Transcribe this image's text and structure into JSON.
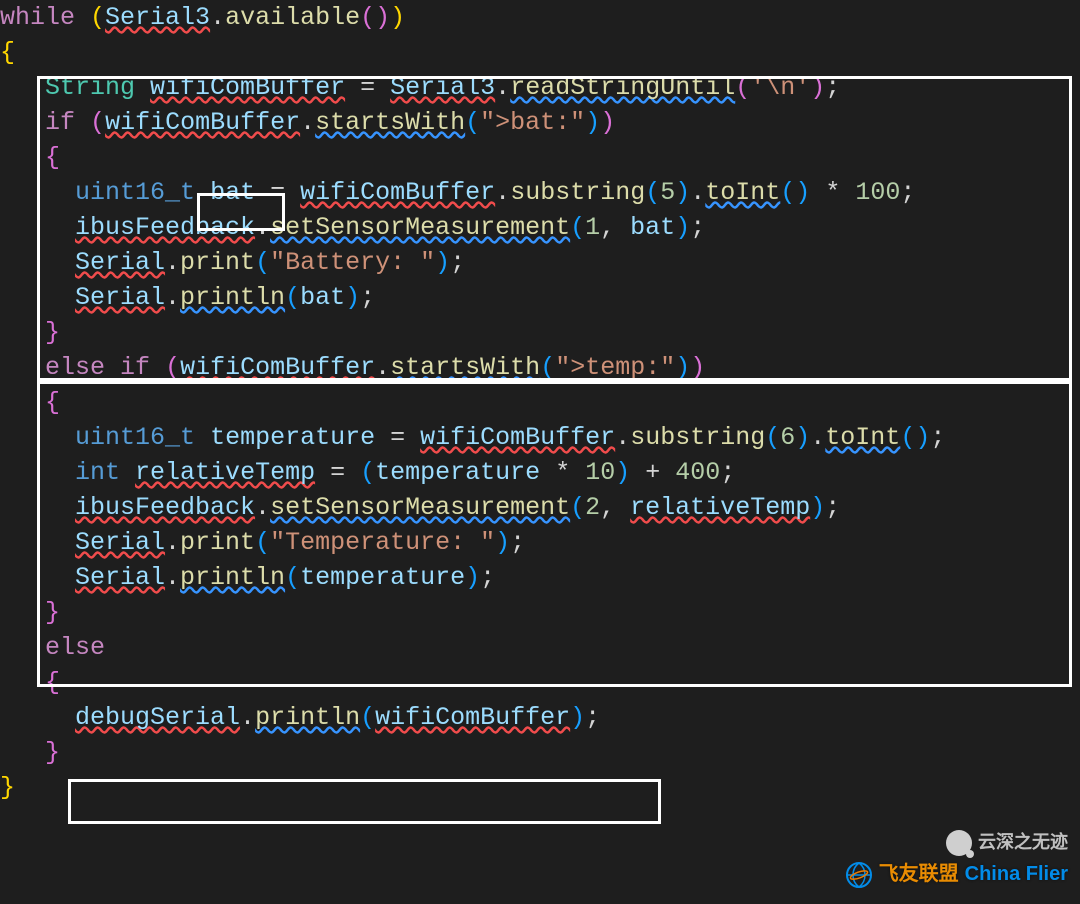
{
  "code": {
    "l1": {
      "kw": "while",
      "obj": "Serial3",
      "dot": ".",
      "fn": "available"
    },
    "l2": {
      "brace": "{"
    },
    "l3": {
      "cls": "String",
      "var": "wifiComBuffer",
      "eq": "=",
      "obj": "Serial3",
      "fn": "readStringUntil",
      "arg": "'\\n'"
    },
    "l4": {
      "kw": "if",
      "var": "wifiComBuffer",
      "fn": "startsWith",
      "arg": "\">bat:\""
    },
    "l5": {
      "brace": "{"
    },
    "l6": {
      "typ": "uint16_t",
      "var": "bat",
      "eq": "=",
      "obj": "wifiComBuffer",
      "fn1": "substring",
      "arg1": "5",
      "fn2": "toInt",
      "op": "*",
      "mul": "100"
    },
    "l7": {
      "obj": "ibusFeedback",
      "fn": "setSensorMeasurement",
      "a1": "1",
      "a2": "bat"
    },
    "l8": {
      "obj": "Serial",
      "fn": "print",
      "arg": "\"Battery: \""
    },
    "l9": {
      "obj": "Serial",
      "fn": "println",
      "arg": "bat"
    },
    "l10": {
      "brace": "}"
    },
    "l11": {
      "kw1": "else",
      "kw2": "if",
      "var": "wifiComBuffer",
      "fn": "startsWith",
      "arg": "\">temp:\""
    },
    "l12": {
      "brace": "{"
    },
    "l13": {
      "typ": "uint16_t",
      "var": "temperature",
      "eq": "=",
      "obj": "wifiComBuffer",
      "fn1": "substring",
      "arg1": "6",
      "fn2": "toInt"
    },
    "l14": {
      "typ": "int",
      "var": "relativeTemp",
      "eq": "=",
      "obj": "temperature",
      "op1": "*",
      "mul": "10",
      "op2": "+",
      "add": "400"
    },
    "l15": {
      "obj": "ibusFeedback",
      "fn": "setSensorMeasurement",
      "a1": "2",
      "a2": "relativeTemp"
    },
    "l16": {
      "obj": "Serial",
      "fn": "print",
      "arg": "\"Temperature: \""
    },
    "l17": {
      "obj": "Serial",
      "fn": "println",
      "arg": "temperature"
    },
    "l18": {
      "brace": "}"
    },
    "l19": {
      "kw": "else"
    },
    "l20": {
      "brace": "{"
    },
    "l21": {
      "obj": "debugSerial",
      "fn": "println",
      "arg": "wifiComBuffer"
    },
    "l22": {
      "brace": "}"
    },
    "l23": {
      "brace": "}"
    }
  },
  "watermark": {
    "brand": "China Flier",
    "tag": "飞友联盟",
    "wm2": "云深之无迹"
  },
  "colors": {
    "bg": "#1e1e1e",
    "keyword": "#c586c0",
    "type": "#569cd6",
    "class": "#4ec9b0",
    "function": "#dcdcaa",
    "variable": "#9cdcfe",
    "number": "#b5cea8",
    "string": "#ce9178",
    "operator": "#d4d4d4",
    "box": "#ffffff"
  }
}
